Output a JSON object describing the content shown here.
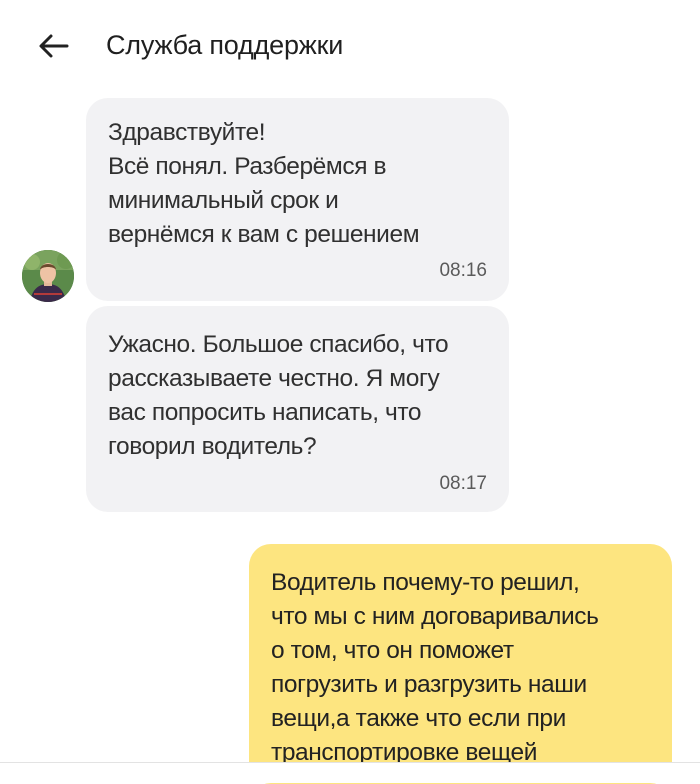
{
  "header": {
    "title": "Служба поддержки",
    "back_icon": "arrow-left-icon"
  },
  "messages": [
    {
      "from": "support",
      "text": "Здравствуйте!\nВсё понял. Разберёмся в\nминимальный срок и\nвернёмся к вам с решением",
      "time": "08:16"
    },
    {
      "from": "support",
      "text": "Ужасно. Большое спасибо, что\nрассказываете честно. Я могу\nвас попросить написать, что\nговорил водитель?",
      "time": "08:17"
    },
    {
      "from": "user",
      "text": "Водитель почему-то решил,\nчто мы с ним договаривались\nо том, что он поможет\nпогрузить и разгрузить наши\nвещи,а также что если при\nтранспортировке вещей"
    }
  ],
  "colors": {
    "incoming_bubble": "#f2f2f4",
    "outgoing_bubble": "#fde580"
  }
}
